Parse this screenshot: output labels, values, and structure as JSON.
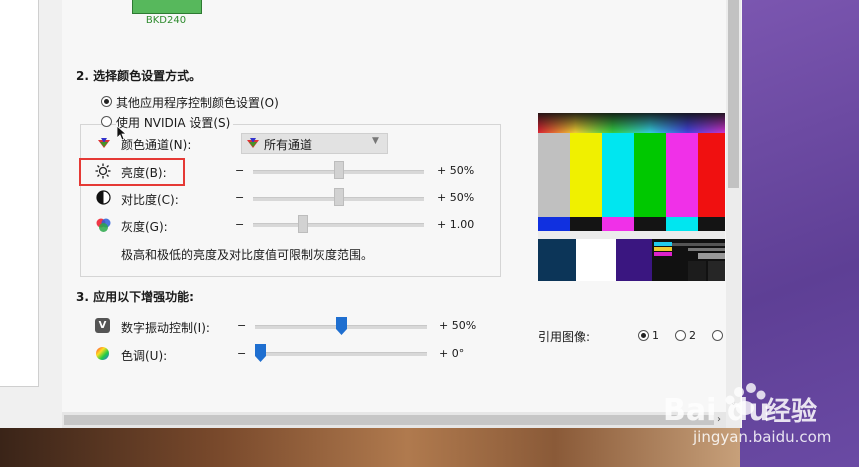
{
  "monitor": {
    "label": "BKD240"
  },
  "section2": {
    "title": "2. 选择颜色设置方式。",
    "option_other": "其他应用程序控制颜色设置(O)",
    "option_nvidia": "使用 NVIDIA 设置(S)",
    "channel_label": "颜色通道(N):",
    "channel_value": "所有通道",
    "brightness_label": "亮度(B):",
    "brightness_value": "+ 50%",
    "contrast_label": "对比度(C):",
    "contrast_value": "+ 50%",
    "gamma_label": "灰度(G):",
    "gamma_value": "+ 1.00",
    "minus": "−",
    "hint": "极高和极低的亮度及对比度值可限制灰度范围。"
  },
  "section3": {
    "title": "3. 应用以下增强功能:",
    "vibrance_label": "数字振动控制(I):",
    "vibrance_value": "+ 50%",
    "hue_label": "色调(U):",
    "hue_value": "+ 0°"
  },
  "reference": {
    "label": "引用图像:",
    "options": [
      "1",
      "2"
    ]
  },
  "levels": {
    "brightness": 0.5,
    "contrast": 0.5,
    "gamma": 0.28,
    "vibrance": 0.5,
    "hue": 0.0
  },
  "selection": {
    "color_mode": "other",
    "reference_image": "1"
  },
  "colors": {
    "highlight_box": "#e53935",
    "slider_blue": "#1f6fd0",
    "purple_bg": "#6b4c9a"
  },
  "watermark": {
    "brand": "Bai du",
    "product": "经验",
    "url": "jingyan.baidu.com"
  },
  "icons": [
    "monitor-icon",
    "channel-icon",
    "brightness-icon",
    "contrast-icon",
    "gamma-icon",
    "vibrance-icon",
    "hue-icon"
  ]
}
